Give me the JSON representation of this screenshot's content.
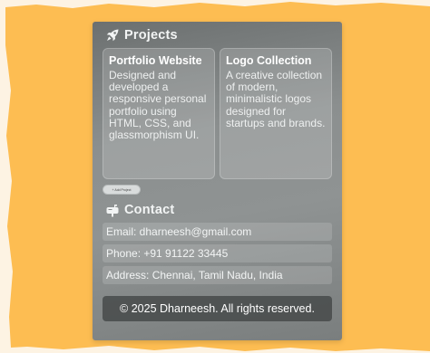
{
  "colors": {
    "background_paper": "#fdbd52",
    "background_page": "#fdf3e3",
    "card_gray": "#8b8f8f",
    "footer_bg": "#464a4a",
    "text_light": "#f2f4f4"
  },
  "projects": {
    "heading_icon": "rocket-icon",
    "heading": "Projects",
    "items": [
      {
        "title": "Portfolio Website",
        "description": "Designed and developed a responsive personal portfolio using HTML, CSS, and glassmorphism UI."
      },
      {
        "title": "Logo Collection",
        "description": "A creative collection of modern, minimalistic logos designed for startups and brands."
      }
    ],
    "add_button_label": "+ Add Project"
  },
  "contact": {
    "heading_icon": "mailbox-icon",
    "heading": "Contact",
    "email": "Email: dharneesh@gmail.com",
    "phone": "Phone: +91 91122 33445",
    "address": "Address: Chennai, Tamil Nadu, India"
  },
  "footer": {
    "text": "© 2025 Dharneesh. All rights reserved."
  }
}
